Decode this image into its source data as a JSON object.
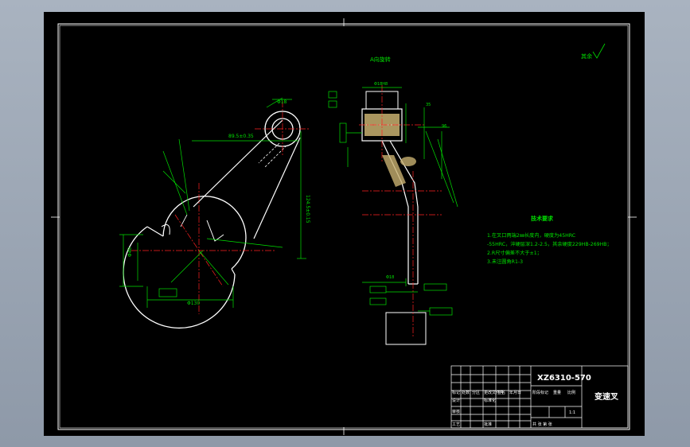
{
  "drawing": {
    "section_label": "A向旋转",
    "surface_finish_label": "其余",
    "tech_requirements": {
      "title": "技术要求",
      "items": [
        "1.在叉口两端2㎜长度内，硬度为45HRC",
        "-55HRC，淬硬层深1.2-2.5，其余硬度229HB-269HB；",
        "2.R尺寸偏差不大于±1；",
        "3.未注圆角R1-3"
      ]
    },
    "title_block": {
      "drawing_no": "XZ6310-570",
      "part_name": "变速叉",
      "scale": "1:1",
      "material_label": "材料",
      "designer_label": "设计",
      "checker_label": "审核",
      "process_label": "工艺",
      "std_label": "标准化",
      "approve_label": "批准",
      "weight_label": "重量",
      "scale_label": "比例",
      "stage_label": "阶段标记",
      "sheet_label": "共 张 第 张",
      "rev_label": "标记",
      "count_label": "处数",
      "zone_label": "分区",
      "change_label": "更改文件号",
      "sign_label": "签名",
      "date_label": "年月日"
    }
  },
  "colors": {
    "background": "#000000",
    "outline": "#ffffff",
    "dimension": "#00e000",
    "centerline": "#ff2020",
    "text": "#ffffff",
    "material": "#c8b070"
  }
}
